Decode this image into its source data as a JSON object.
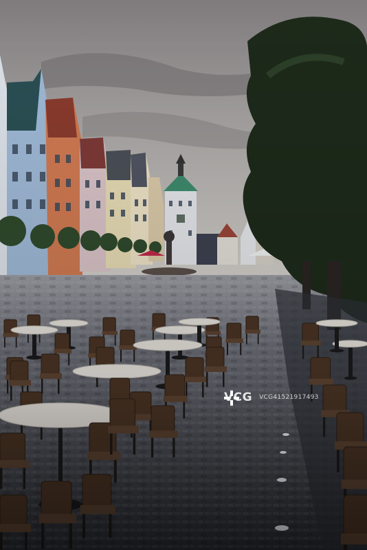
{
  "photo": {
    "subject": "old-town-square-cafe-terrace",
    "watermark": {
      "brand": "VCG",
      "id": "VCG41521917493"
    }
  },
  "colors": {
    "sky_top": "#8e8a8c",
    "sky_bottom": "#c9c8c6",
    "cobble_dark": "#3a3c44",
    "cobble_light": "#8d8f98",
    "tree_dark": "#1f2a1c",
    "chair_brown": "#4a3424",
    "table_top": "#e6e2dc"
  }
}
